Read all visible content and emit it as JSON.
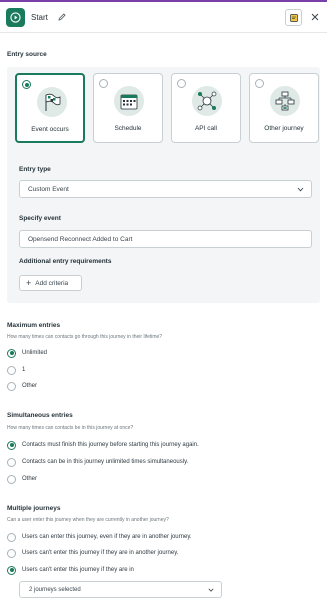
{
  "header": {
    "title": "Start"
  },
  "entry_source": {
    "heading": "Entry source",
    "cards": [
      {
        "label": "Event occurs",
        "selected": true
      },
      {
        "label": "Schedule",
        "selected": false
      },
      {
        "label": "API call",
        "selected": false
      },
      {
        "label": "Other journey",
        "selected": false
      }
    ],
    "entry_type": {
      "label": "Entry type",
      "value": "Custom Event"
    },
    "specify_event": {
      "label": "Specify event",
      "value": "Opensend Reconnect Added to Cart"
    },
    "additional": {
      "label": "Additional entry requirements",
      "button": "Add criteria"
    }
  },
  "maximum_entries": {
    "title": "Maximum entries",
    "help": "How many times can contacts go through this journey in their lifetime?",
    "options": [
      {
        "label": "Unlimited",
        "selected": true
      },
      {
        "label": "1",
        "selected": false
      },
      {
        "label": "Other",
        "selected": false
      }
    ]
  },
  "simultaneous_entries": {
    "title": "Simultaneous entries",
    "help": "How many times can contacts be in this journey at once?",
    "options": [
      {
        "label": "Contacts must finish this journey before starting this journey again.",
        "selected": true
      },
      {
        "label": "Contacts can be in this journey unlimited times simultaneously.",
        "selected": false
      },
      {
        "label": "Other",
        "selected": false
      }
    ]
  },
  "multiple_journeys": {
    "title": "Multiple journeys",
    "help": "Can a user enter this journey when they are currently in another journey?",
    "options": [
      {
        "label": "Users can enter this journey, even if they are in another journey.",
        "selected": false
      },
      {
        "label": "Users can't enter this journey if they are in another journey.",
        "selected": false
      },
      {
        "label": "Users can't enter this journey if they are in",
        "selected": true
      }
    ],
    "journeys_select": "2 journeys selected"
  },
  "colors": {
    "accent": "#1a7a5c",
    "top_border": "#7a3fa8"
  }
}
